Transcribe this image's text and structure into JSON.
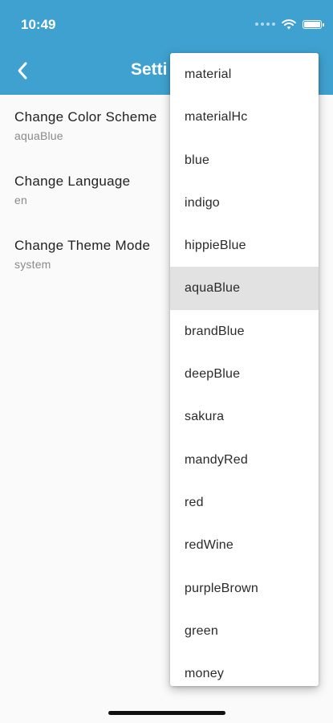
{
  "status_bar": {
    "time": "10:49"
  },
  "app_bar": {
    "title": "Setti"
  },
  "settings": [
    {
      "title": "Change Color Scheme",
      "value": "aquaBlue"
    },
    {
      "title": "Change Language",
      "value": "en"
    },
    {
      "title": "Change Theme Mode",
      "value": "system"
    }
  ],
  "dropdown": {
    "selected": "aquaBlue",
    "options": [
      "material",
      "materialHc",
      "blue",
      "indigo",
      "hippieBlue",
      "aquaBlue",
      "brandBlue",
      "deepBlue",
      "sakura",
      "mandyRed",
      "red",
      "redWine",
      "purpleBrown",
      "green",
      "money"
    ]
  },
  "colors": {
    "app_bar": "#3fa1cf",
    "selected_option_bg": "#e2e2e2"
  }
}
